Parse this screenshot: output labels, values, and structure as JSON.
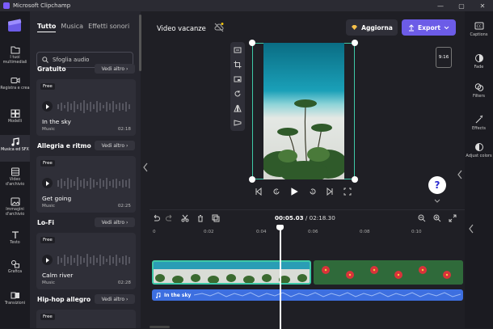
{
  "window": {
    "title": "Microsoft Clipchamp",
    "controls": [
      "—",
      "▢",
      "✕"
    ]
  },
  "leftnav": {
    "items": [
      {
        "label": "I tuoi multimediali",
        "icon": "folder-icon"
      },
      {
        "label": "Registra e crea",
        "icon": "camera-icon"
      },
      {
        "label": "Modelli",
        "icon": "templates-icon"
      },
      {
        "label": "Musica ed SFX",
        "icon": "music-note-icon",
        "active": true
      },
      {
        "label": "Video d'archivio",
        "icon": "film-icon"
      },
      {
        "label": "Immagini d'archivio",
        "icon": "image-icon"
      },
      {
        "label": "Testo",
        "icon": "text-icon"
      },
      {
        "label": "Grafica",
        "icon": "shapes-icon"
      },
      {
        "label": "Transizioni",
        "icon": "transition-icon"
      }
    ]
  },
  "library": {
    "tabs": [
      "Tutto",
      "Musica",
      "Effetti sonori"
    ],
    "active_tab": "Tutto",
    "search_placeholder": "Sfoglia audio",
    "see_all": "Vedi altro ›",
    "sections": [
      {
        "title": "Gratuito",
        "track": {
          "badge": "Free",
          "name": "In the sky",
          "category": "Music",
          "duration": "02:18"
        }
      },
      {
        "title": "Allegria e ritmo",
        "track": {
          "badge": "Free",
          "name": "Get going",
          "category": "Music",
          "duration": "02:25"
        }
      },
      {
        "title": "Lo-Fi",
        "track": {
          "badge": "Free",
          "name": "Calm river",
          "category": "Music",
          "duration": "02:28"
        }
      },
      {
        "title": "Hip-hop allegro",
        "track": {
          "badge": "Free",
          "name": "",
          "category": "",
          "duration": ""
        }
      }
    ]
  },
  "editor": {
    "project_title": "Video vacanze",
    "upgrade_label": "Aggiorna",
    "export_label": "Export",
    "aspect_ratio": "9:16",
    "help_label": "?"
  },
  "rightpanel": {
    "items": [
      {
        "label": "Captions",
        "icon": "captions-icon"
      },
      {
        "label": "Fade",
        "icon": "fade-icon"
      },
      {
        "label": "Filters",
        "icon": "filters-icon"
      },
      {
        "label": "Effects",
        "icon": "effects-icon"
      },
      {
        "label": "Adjust colors",
        "icon": "adjust-colors-icon"
      }
    ]
  },
  "timeline": {
    "current_time": "00:05.03",
    "total_time": "02:18.30",
    "separator": " / ",
    "ruler_ticks": [
      "0",
      "0:02",
      "0:04",
      "0:06",
      "0:08",
      "0:10"
    ],
    "audio_track_name": "In the sky",
    "colors": {
      "audio": "#3d6fe0",
      "selected_clip_border": "#3ec9a7",
      "accent": "#6c5ce7"
    }
  }
}
